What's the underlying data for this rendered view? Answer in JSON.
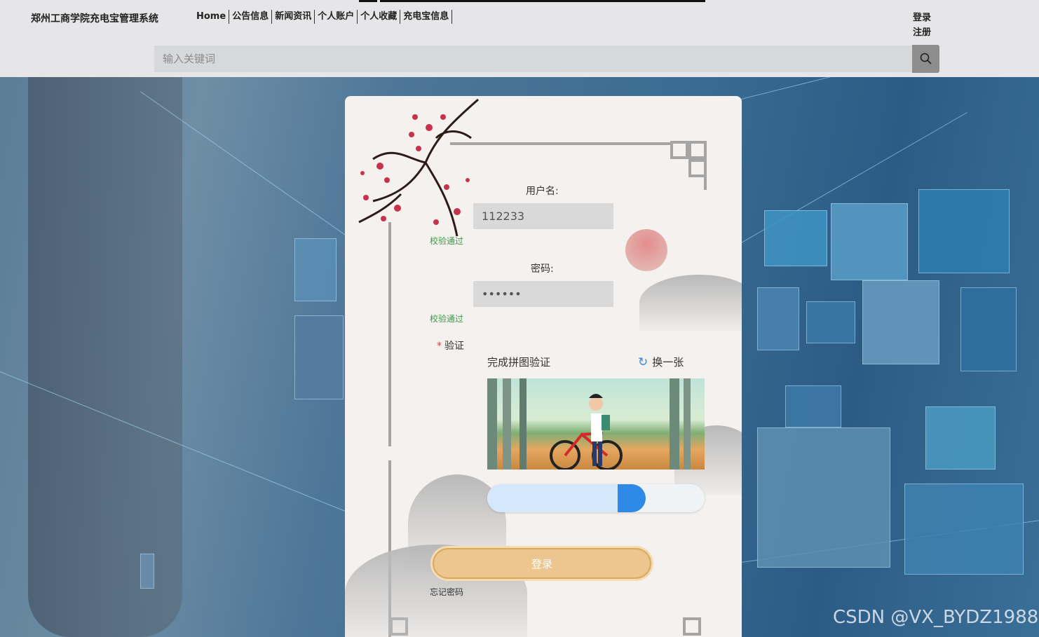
{
  "header": {
    "site_title": "郑州工商学院充电宝管理系统",
    "nav": [
      "Home",
      "公告信息",
      "新闻资讯",
      "个人账户",
      "个人收藏",
      "充电宝信息"
    ],
    "login_link": "登录",
    "register_link": "注册",
    "search_placeholder": "输入关键词"
  },
  "login": {
    "username_label": "用户名:",
    "username_value": "112233",
    "username_status": "校验通过",
    "password_label": "密码:",
    "password_value": "••••••",
    "password_status": "校验通过",
    "verify_label": "验证",
    "captcha_title": "完成拼图验证",
    "captcha_refresh": "换一张",
    "slider_progress": 0.65,
    "submit_label": "登录",
    "forgot_label": "忘记密码"
  },
  "watermark": "CSDN @VX_BYDZ1988",
  "colors": {
    "accent": "#2e8ae6",
    "success": "#3a9a4a",
    "button": "#ecc68e",
    "header_bg": "#e6e6e8"
  }
}
